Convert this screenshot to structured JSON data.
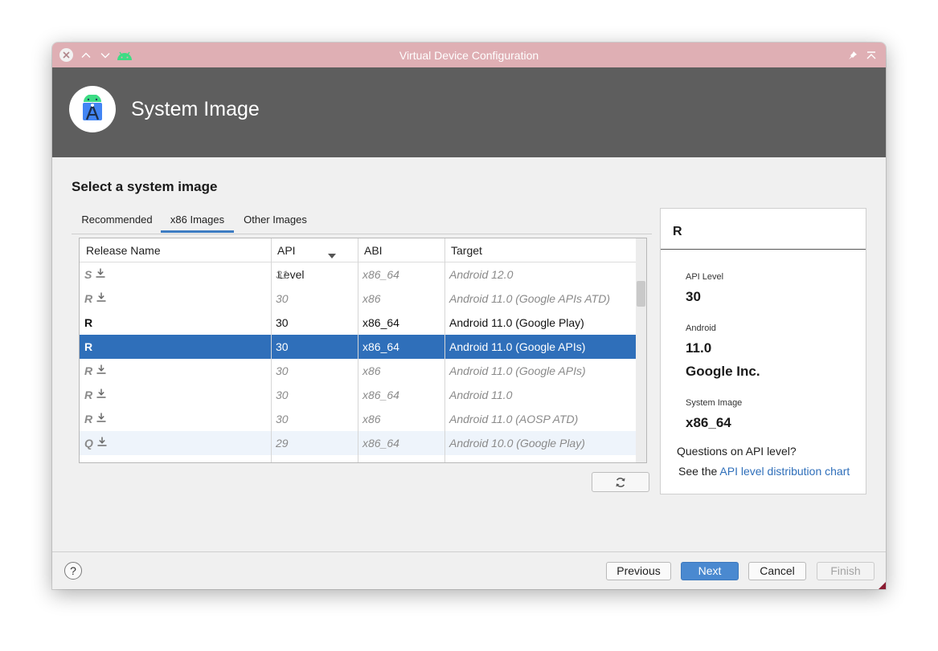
{
  "window": {
    "title": "Virtual Device Configuration"
  },
  "header": {
    "title": "System Image"
  },
  "page": {
    "section_title": "Select a system image"
  },
  "tabs": [
    {
      "label": "Recommended"
    },
    {
      "label": "x86 Images"
    },
    {
      "label": "Other Images"
    }
  ],
  "active_tab": "x86 Images",
  "table": {
    "columns": [
      "Release Name",
      "API Level",
      "ABI",
      "Target"
    ],
    "sort_column": "API Level",
    "rows": [
      {
        "release": "S",
        "api": "31",
        "abi": "x86_64",
        "target": "Android 12.0",
        "downloaded": false
      },
      {
        "release": "R",
        "api": "30",
        "abi": "x86",
        "target": "Android 11.0 (Google APIs ATD)",
        "downloaded": false
      },
      {
        "release": "R",
        "api": "30",
        "abi": "x86_64",
        "target": "Android 11.0 (Google Play)",
        "downloaded": true
      },
      {
        "release": "R",
        "api": "30",
        "abi": "x86_64",
        "target": "Android 11.0 (Google APIs)",
        "downloaded": true,
        "selected": true
      },
      {
        "release": "R",
        "api": "30",
        "abi": "x86",
        "target": "Android 11.0 (Google APIs)",
        "downloaded": false
      },
      {
        "release": "R",
        "api": "30",
        "abi": "x86_64",
        "target": "Android 11.0",
        "downloaded": false
      },
      {
        "release": "R",
        "api": "30",
        "abi": "x86",
        "target": "Android 11.0 (AOSP ATD)",
        "downloaded": false
      },
      {
        "release": "Q",
        "api": "29",
        "abi": "x86_64",
        "target": "Android 10.0 (Google Play)",
        "downloaded": false,
        "hovered": true
      }
    ]
  },
  "details": {
    "title": "R",
    "api_label": "API Level",
    "api_value": "30",
    "android_label": "Android",
    "android_value": "11.0",
    "vendor": "Google Inc.",
    "system_image_label": "System Image",
    "system_image_value": "x86_64",
    "question": "Questions on API level?",
    "see_prefix": "See the ",
    "see_link": "API level distribution chart"
  },
  "footer": {
    "help_label": "?",
    "previous": "Previous",
    "next": "Next",
    "cancel": "Cancel",
    "finish": "Finish"
  },
  "colors": {
    "titlebar": "#dfafb4",
    "header": "#5e5e5e",
    "selection": "#2f6fba",
    "primary_button": "#4a89d0",
    "link": "#2f6fba"
  },
  "icons": [
    "close-icon",
    "minimize-icon",
    "maximize-icon",
    "android-icon",
    "pin-icon",
    "restore-icon",
    "android-studio-logo",
    "download-icon",
    "sort-down-icon",
    "refresh-icon"
  ]
}
